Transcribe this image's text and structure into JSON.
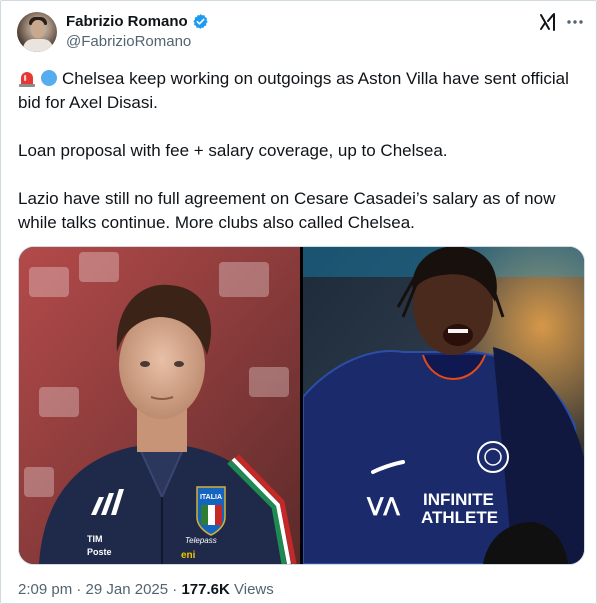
{
  "author": {
    "name": "Fabrizio Romano",
    "handle": "@FabrizioRomano",
    "verified": true,
    "avatar": "avatar-photo"
  },
  "header_icons": [
    "grok-icon",
    "more-options-icon"
  ],
  "tweet": {
    "emojis": [
      "rotating-light-emoji",
      "blue-circle-emoji"
    ],
    "line1": "Chelsea keep working on outgoings as Aston Villa have sent official bid for Axel Disasi.",
    "line2": "Loan proposal with fee + salary coverage, up to Chelsea.",
    "line3": "Lazio have still no full agreement on Cesare Casadei’s salary as of now while talks continue. More clubs also called Chelsea."
  },
  "media": {
    "left": {
      "kit_brand_left": "TIM",
      "kit_brand_left2": "Poste",
      "crest": "ITALIA",
      "sponsor1": "Telepass",
      "sponsor2": "eni"
    },
    "right": {
      "shirt_line1": "INFINITE",
      "shirt_line2": "ATHLETE"
    }
  },
  "meta": {
    "time": "2:09 pm",
    "separator": "·",
    "date": "29 Jan 2025",
    "views_count": "177.6K",
    "views_label": "Views"
  },
  "colors": {
    "text": "#0f1419",
    "secondary": "#536471",
    "verified_blue": "#1d9bf0",
    "border": "#cfd9de"
  }
}
